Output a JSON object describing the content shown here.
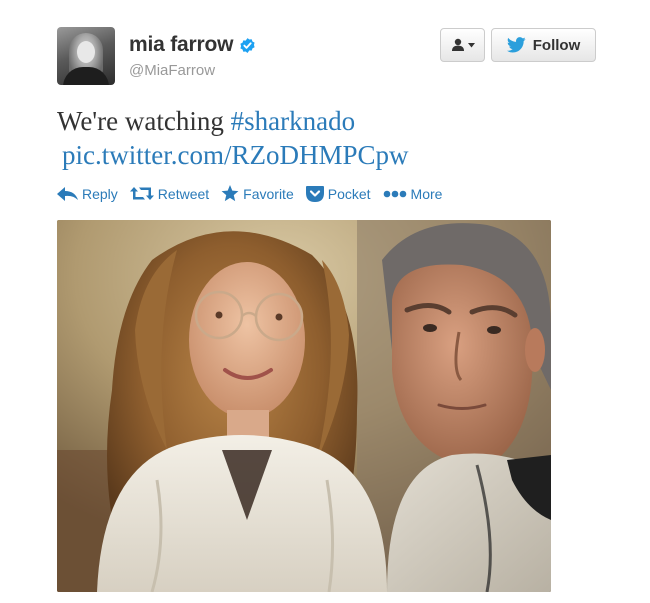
{
  "user": {
    "display_name": "mia farrow",
    "handle": "@MiaFarrow",
    "verified": true,
    "avatar_icon": "profile-photo"
  },
  "header_buttons": {
    "user_actions_icon": "person-dropdown-icon",
    "follow_label": "Follow",
    "follow_icon": "twitter-bird-icon"
  },
  "tweet": {
    "text_prefix": "We're watching ",
    "hashtag": "#sharknado",
    "link": "pic.twitter.com/RZoDHMPCpw"
  },
  "actions": [
    {
      "label": "Reply",
      "icon": "reply-arrow-icon"
    },
    {
      "label": "Retweet",
      "icon": "retweet-icon"
    },
    {
      "label": "Favorite",
      "icon": "star-icon"
    },
    {
      "label": "Pocket",
      "icon": "pocket-icon"
    },
    {
      "label": "More",
      "icon": "ellipsis-icon"
    }
  ],
  "media": {
    "type": "photo"
  },
  "colors": {
    "link": "#2b7bb9",
    "name": "#333333",
    "handle": "#999999",
    "verified": "#1da1f2",
    "twitter_blue": "#2b9fdc"
  }
}
